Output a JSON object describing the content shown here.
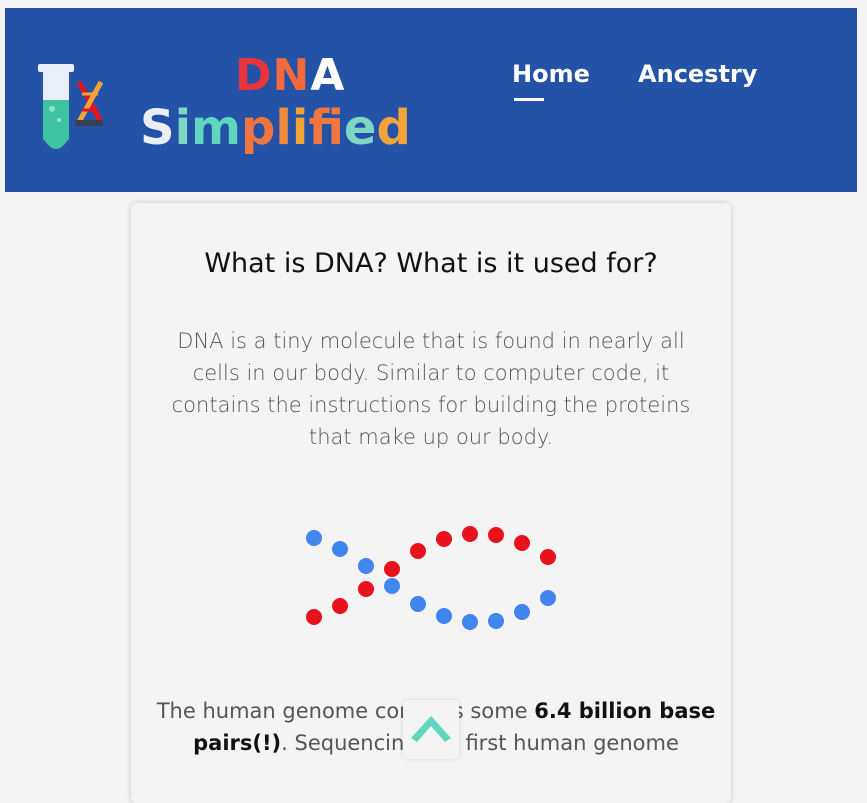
{
  "header": {
    "brand_top": "DNA",
    "brand_bottom": "Simplified",
    "nav": [
      {
        "label": "Home",
        "active": true
      },
      {
        "label": "Ancestry",
        "active": false
      }
    ],
    "background": "#2352a7"
  },
  "card": {
    "title": "What is DNA? What is it used for?",
    "paragraph": "DNA is a tiny molecule that is found in nearly all cells in our body. Similar to computer code, it contains the instructions for building the proteins that make up our body.",
    "paragraph2_prefix": "The human genome contains some ",
    "paragraph2_bold": "6.4 billion base pairs(!)",
    "paragraph2_suffix": ". Sequencing the first human genome"
  },
  "helix_colors": {
    "red": "#e8121c",
    "blue": "#4185ef"
  },
  "scroll_top": {
    "icon": "chevron-up-icon",
    "color": "#5fd6bd"
  }
}
